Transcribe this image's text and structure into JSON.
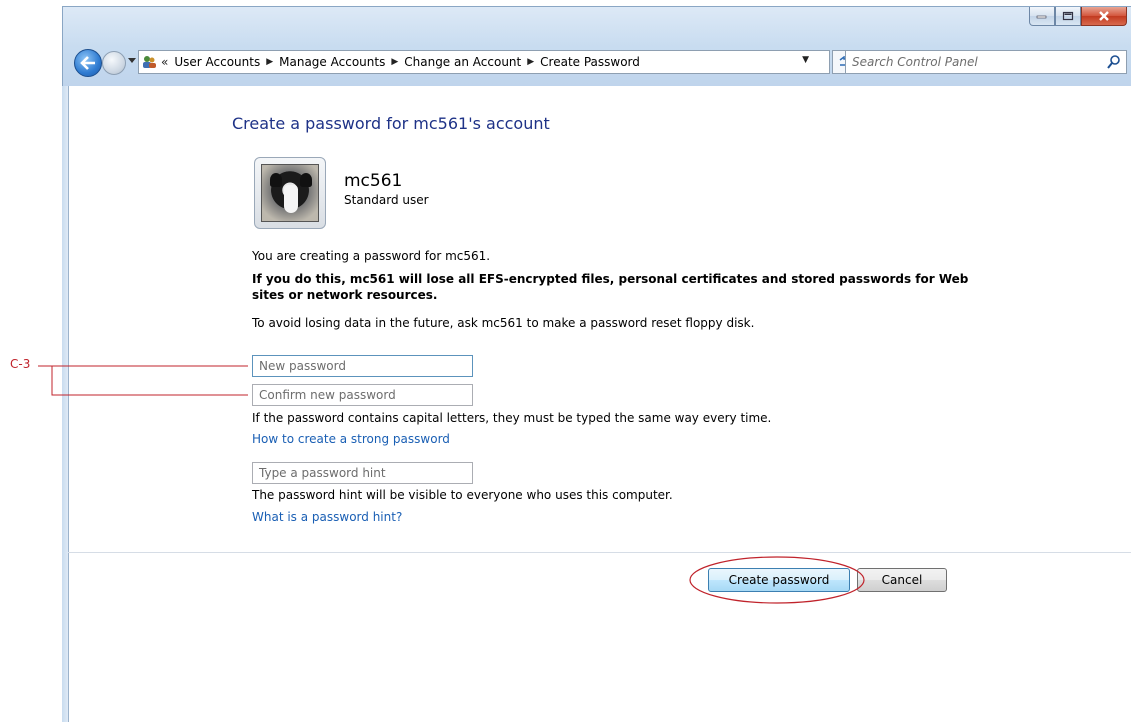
{
  "window": {
    "caption_buttons": [
      "minimize",
      "maximize",
      "close"
    ]
  },
  "nav": {
    "breadcrumbs": [
      "User Accounts",
      "Manage Accounts",
      "Change an Account",
      "Create Password"
    ],
    "breadcrumb_prefix": "«",
    "search_placeholder": "Search Control Panel"
  },
  "page": {
    "title": "Create a password for mc561's account",
    "user": {
      "name": "mc561",
      "type": "Standard user"
    },
    "intro": "You are creating a password for mc561.",
    "warning": "If you do this, mc561 will lose all EFS-encrypted files, personal certificates and stored passwords for Web sites or network resources.",
    "advice": "To avoid losing data in the future, ask mc561 to make a password reset floppy disk.",
    "fields": {
      "new_password": "New password",
      "confirm_password": "Confirm new password",
      "hint": "Type a password hint"
    },
    "capital_note": "If the password contains capital letters, they must be typed the same way every time.",
    "strong_link": "How to create a strong password",
    "hint_note": "The password hint will be visible to everyone who uses this computer.",
    "hint_link": "What is a password hint?",
    "buttons": {
      "create": "Create password",
      "cancel": "Cancel"
    }
  },
  "annotation": {
    "label": "C-3",
    "color": "#c0232b"
  }
}
